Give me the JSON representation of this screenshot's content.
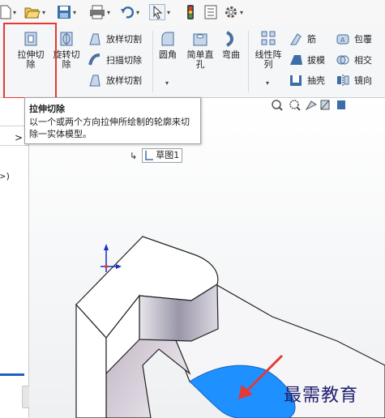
{
  "quick_access": {
    "items": [
      "new-document-icon",
      "open-file-icon",
      "save-icon",
      "print-icon",
      "undo-icon",
      "select-pointer-icon",
      "traffic-light-icon",
      "file-properties-icon",
      "options-gear-icon"
    ]
  },
  "ribbon": {
    "extrude_cut": "拉伸切\n除",
    "revolve_cut": "旋转切\n除",
    "loft_cut_top": "放样切割",
    "sweep_cut": "扫描切除",
    "loft_cut_bottom": "放样切割",
    "fillet": "圆角",
    "simple_hole": "简单直\n孔",
    "flex": "弯曲",
    "linear_pattern": "线性阵\n列",
    "rib": "筋",
    "draft": "拔模",
    "shell": "抽壳",
    "wrap": "包覆",
    "intersect": "相交",
    "mirror": "镜向"
  },
  "tooltip": {
    "title": "拉伸切除",
    "body": "以一个或两个方向拉伸所绘制的轮廓来切除一实体模型。"
  },
  "left_panel": {
    "fragment": ">)",
    "expand_arrow": ">"
  },
  "graphics": {
    "sketch_label": "草图1"
  },
  "watermark": "最需教育",
  "colors": {
    "highlight": "#e53935",
    "selected_face": "#1e90ff",
    "arrow": "#e53935"
  }
}
